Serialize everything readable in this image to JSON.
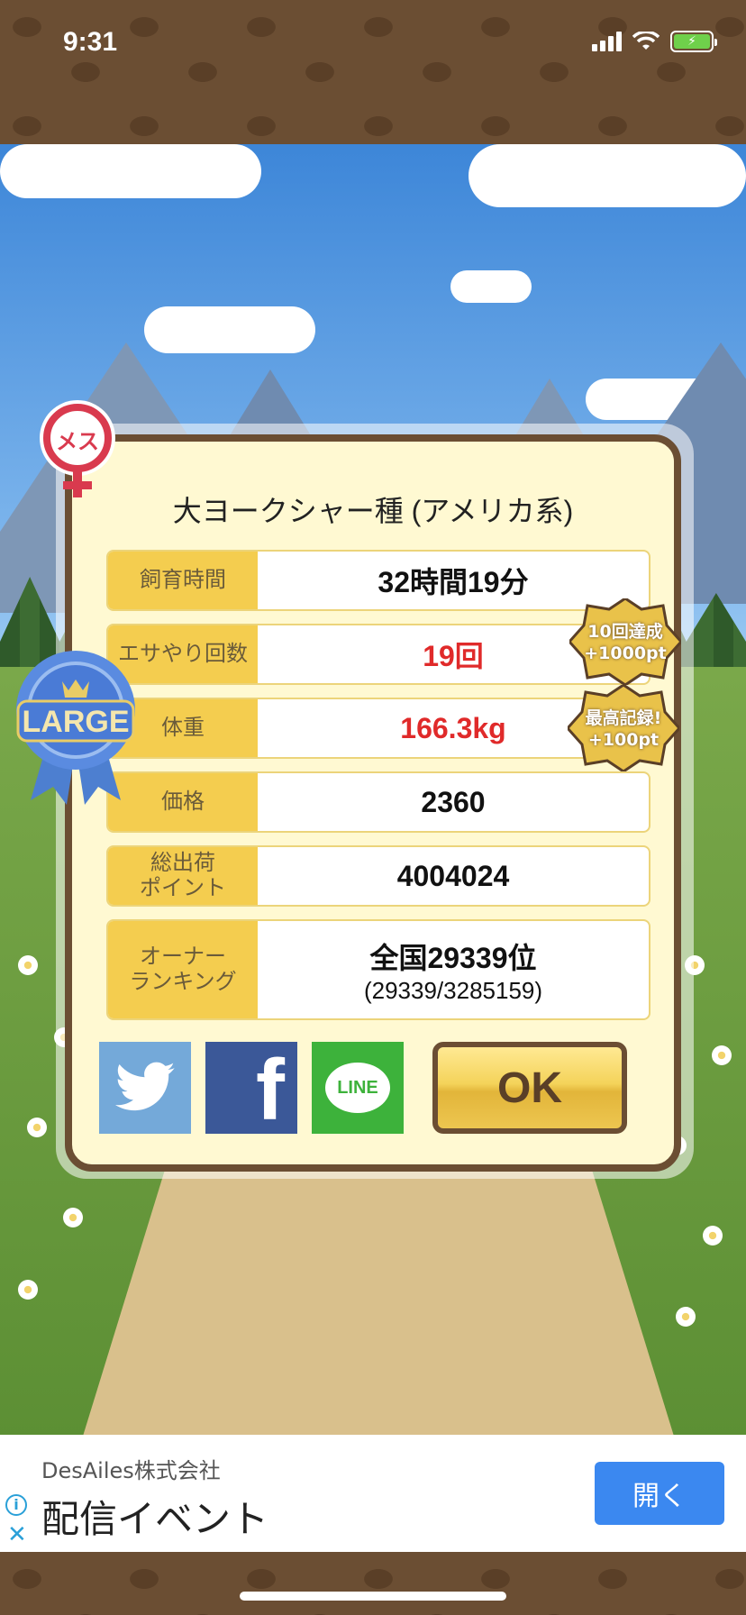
{
  "status_bar": {
    "time": "9:31"
  },
  "card": {
    "gender_badge": "メス",
    "size_badge": "LARGE",
    "breed": "大ヨークシャー種 (アメリカ系)",
    "rows": [
      {
        "label": "飼育時間",
        "value": "32時間19分",
        "highlight": false
      },
      {
        "label": "エサやり回数",
        "value": "19回",
        "highlight": true
      },
      {
        "label": "体重",
        "value": "166.3kg",
        "highlight": true
      },
      {
        "label": "価格",
        "value": "2360",
        "highlight": false
      },
      {
        "label": "総出荷\nポイント",
        "value": "4004024",
        "highlight": false
      },
      {
        "label": "オーナー\nランキング",
        "value": "全国29339位",
        "sub": "(29339/3285159)",
        "highlight": false
      }
    ],
    "achievements": [
      {
        "line1": "10回達成",
        "line2": "+1000pt"
      },
      {
        "line1": "最高記録!",
        "line2": "+100pt"
      }
    ],
    "social": {
      "twitter_icon": "twitter-bird-icon",
      "facebook_icon": "facebook-f-icon",
      "line_label": "LINE"
    },
    "ok_label": "OK"
  },
  "ad": {
    "company": "DesAiles株式会社",
    "title": "配信イベント",
    "open_label": "開く"
  },
  "colors": {
    "label_bg": "#f4cd4f",
    "highlight_text": "#e02a2a",
    "frame_brown": "#6b4e33",
    "ad_button": "#3b88f0"
  }
}
